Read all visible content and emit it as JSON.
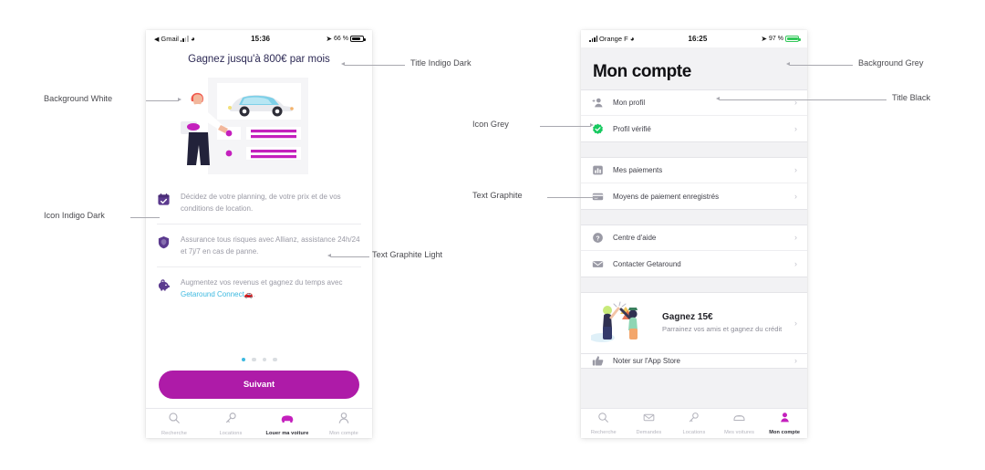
{
  "annotations": [
    {
      "id": "background-white",
      "label": "Background White"
    },
    {
      "id": "icon-indigo-dark",
      "label": "Icon Indigo Dark"
    },
    {
      "id": "title-indigo-dark",
      "label": "Title Indigo Dark"
    },
    {
      "id": "text-graphite-light",
      "label": "Text Graphite Light"
    },
    {
      "id": "icon-grey",
      "label": "Icon Grey"
    },
    {
      "id": "text-graphite",
      "label": "Text Graphite"
    },
    {
      "id": "background-grey",
      "label": "Background Grey"
    },
    {
      "id": "title-black",
      "label": "Title Black"
    }
  ],
  "colors": {
    "magenta": "#AE1BA8",
    "indigo_dark": "#2d2a55",
    "graphite": "#3f3f48",
    "graphite_light": "#9a9aa5",
    "grey_icon": "#8e8e99",
    "background_grey": "#f2f2f4",
    "background_white": "#ffffff",
    "title_black": "#111114",
    "accent_blue": "#3db9e0",
    "verified_green": "#16c95f"
  },
  "left_phone": {
    "status_bar": {
      "back_label": "Gmail",
      "time": "15:36",
      "battery_text": "66 %",
      "location_icon": "location-arrow-icon",
      "wifi_icon": "wifi-icon",
      "signal_icon": "signal-bars-icon"
    },
    "title": "Gagnez jusqu'à 800€ par mois",
    "illustration_name": "host-presenting-car-listing-illustration",
    "features": [
      {
        "icon": "calendar-check-icon",
        "text": "Décidez de votre planning, de votre prix et de vos conditions de location."
      },
      {
        "icon": "shield-insurance-icon",
        "text": "Assurance tous risques avec Allianz, assistance 24h/24 et 7j/7 en cas de panne."
      },
      {
        "icon": "piggy-bank-icon",
        "text_before": "Augmentez vos revenus et gagnez du temps avec ",
        "link": "Getaround Connect",
        "text_after": "."
      }
    ],
    "pagination": {
      "total": 4,
      "active_index": 0
    },
    "cta_label": "Suivant",
    "tabs": [
      {
        "label": "Recherche",
        "icon": "search-icon",
        "active": false
      },
      {
        "label": "Locations",
        "icon": "key-icon",
        "active": false
      },
      {
        "label": "Louer ma voiture",
        "icon": "car-icon",
        "active": true
      },
      {
        "label": "Mon compte",
        "icon": "person-icon",
        "active": false
      }
    ]
  },
  "right_phone": {
    "status_bar": {
      "carrier": "Orange F",
      "time": "16:25",
      "battery_text": "97 %",
      "location_icon": "location-arrow-icon",
      "wifi_icon": "wifi-icon",
      "signal_icon": "signal-bars-icon"
    },
    "title": "Mon compte",
    "groups": [
      {
        "rows": [
          {
            "label": "Mon profil",
            "icon": "person-add-icon"
          },
          {
            "label": "Profil vérifié",
            "icon": "verified-badge-icon"
          }
        ]
      },
      {
        "rows": [
          {
            "label": "Mes paiements",
            "icon": "bar-chart-icon"
          },
          {
            "label": "Moyens de paiement enregistrés",
            "icon": "credit-card-icon"
          }
        ]
      },
      {
        "rows": [
          {
            "label": "Centre d'aide",
            "icon": "question-circle-icon"
          },
          {
            "label": "Contacter Getaround",
            "icon": "envelope-icon"
          }
        ]
      }
    ],
    "promo": {
      "title": "Gagnez 15€",
      "subtitle": "Parrainez vos amis et gagnez du crédit",
      "art_name": "friends-high-five-illustration"
    },
    "partial_row": {
      "label": "Noter sur l'App Store",
      "icon": "thumbs-up-icon"
    },
    "tabs": [
      {
        "label": "Recherche",
        "icon": "search-icon",
        "active": false
      },
      {
        "label": "Demandes",
        "icon": "envelope-icon",
        "active": false
      },
      {
        "label": "Locations",
        "icon": "key-icon",
        "active": false
      },
      {
        "label": "Mes voitures",
        "icon": "car-icon",
        "active": false
      },
      {
        "label": "Mon compte",
        "icon": "person-icon",
        "active": true
      }
    ]
  }
}
